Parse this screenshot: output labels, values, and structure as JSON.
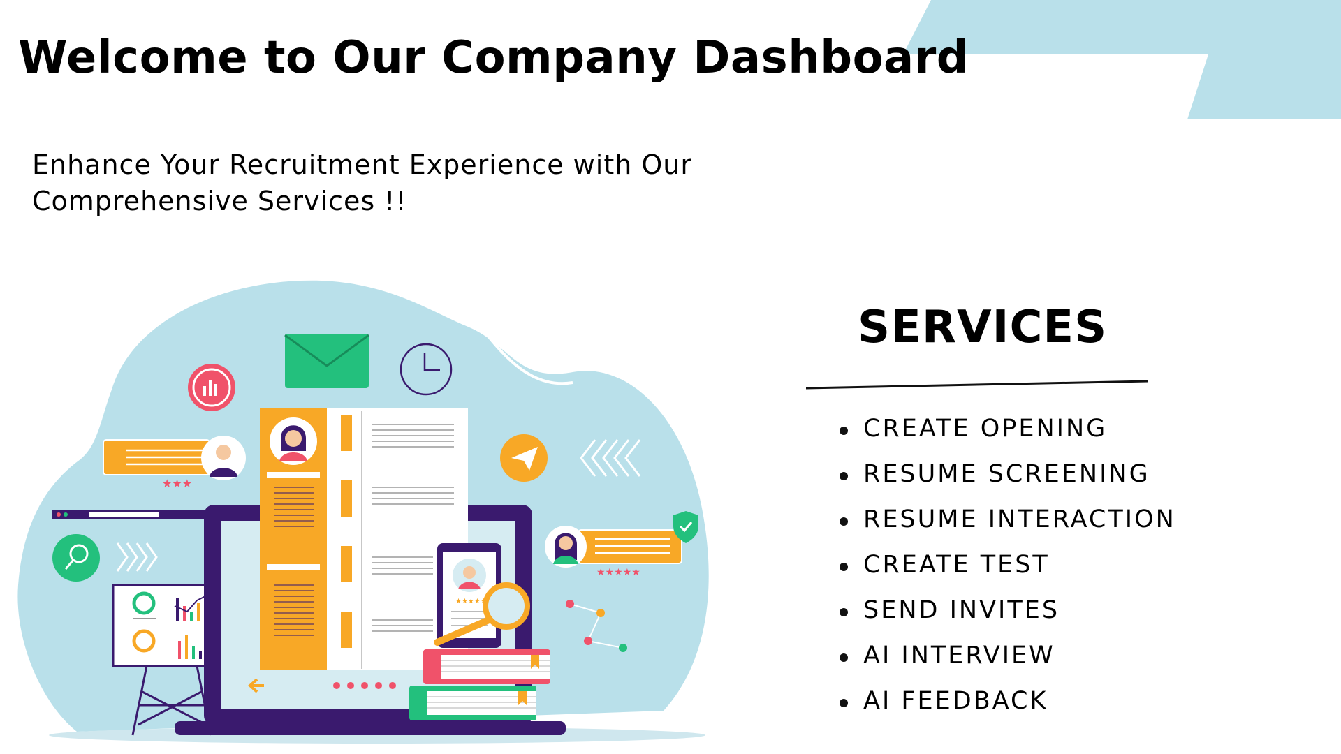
{
  "header": {
    "title": "Welcome to Our Company Dashboard",
    "subtitle": "Enhance Your Recruitment Experience with Our Comprehensive Services !!"
  },
  "services": {
    "heading": "SERVICES",
    "items": [
      "CREATE OPENING",
      "RESUME SCREENING",
      "RESUME INTERACTION",
      "CREATE TEST",
      "SEND INVITES",
      "AI INTERVIEW",
      "AI FEEDBACK"
    ]
  },
  "colors": {
    "accent_light_blue": "#b9e0ea",
    "orange": "#f8a826",
    "purple": "#3a1a6e",
    "green": "#23c07d",
    "coral": "#f0526a"
  }
}
